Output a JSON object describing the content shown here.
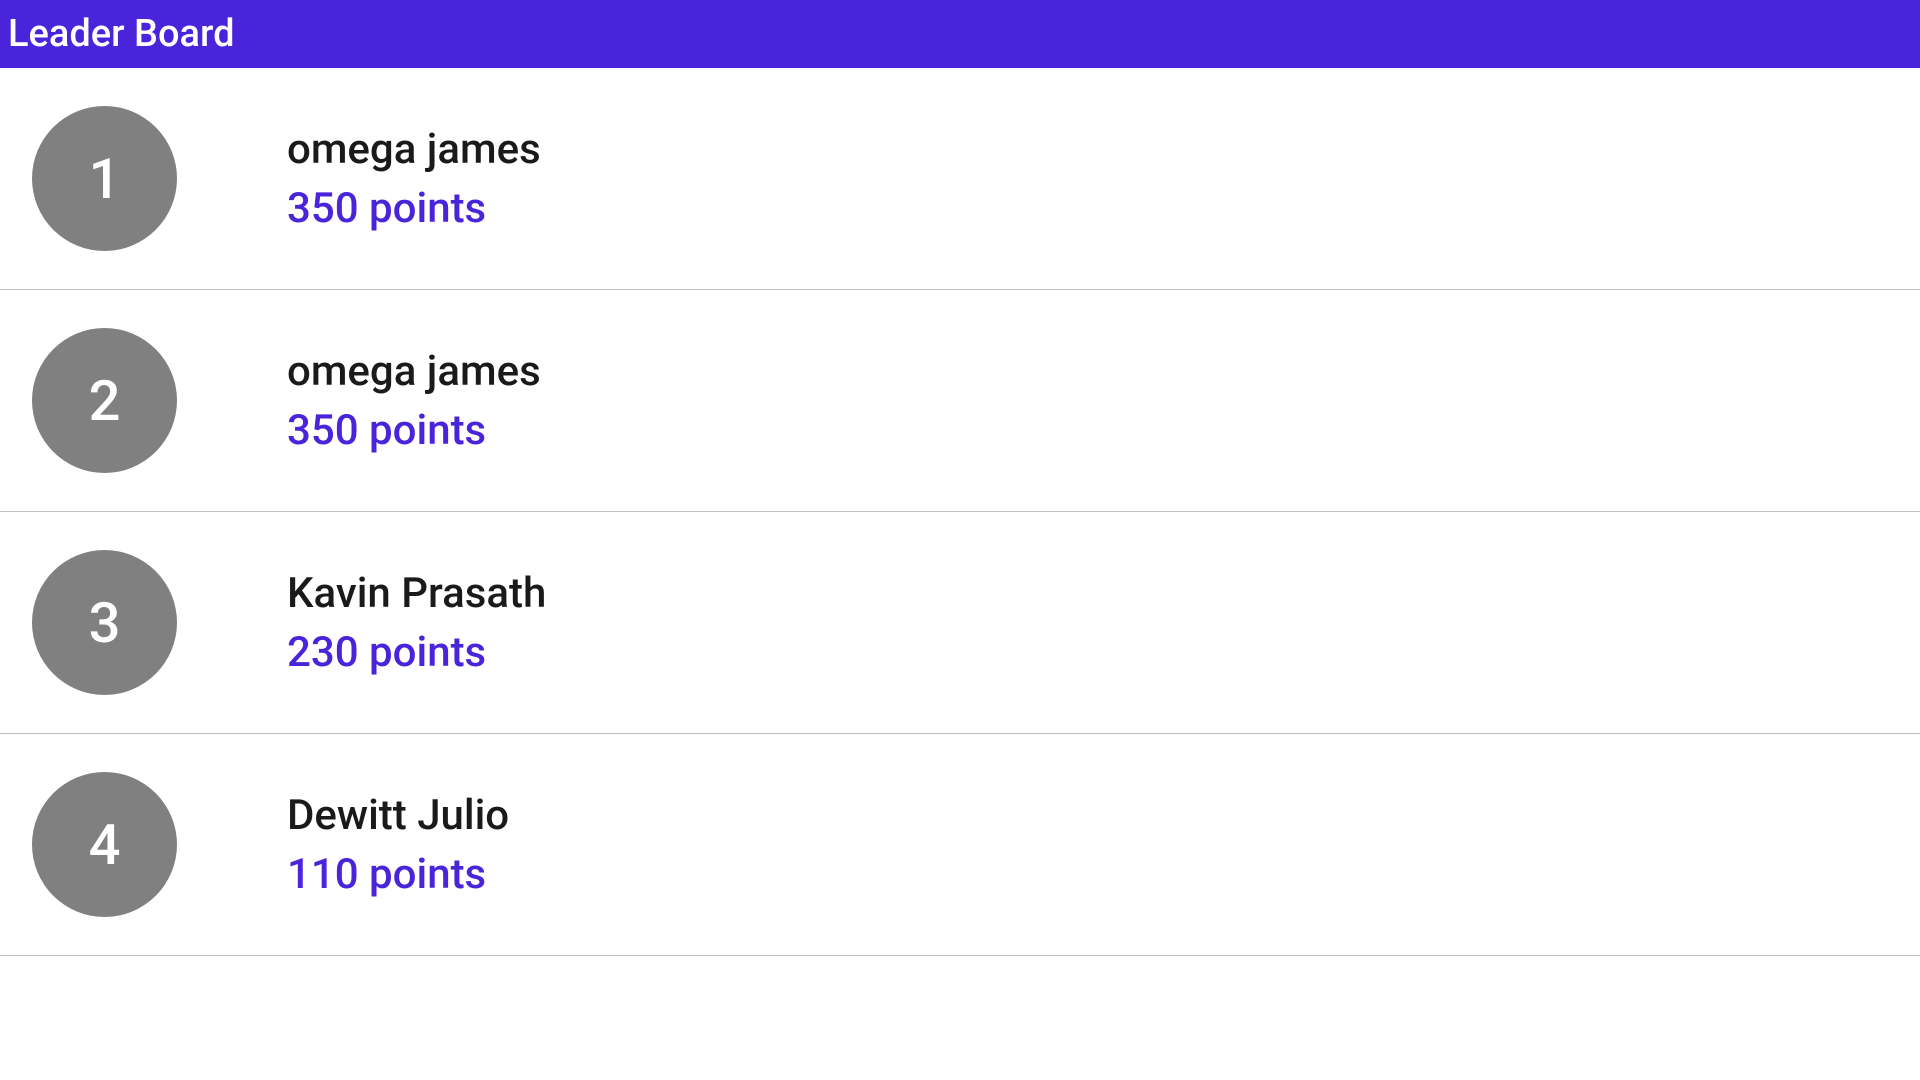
{
  "header": {
    "title": "Leader Board"
  },
  "leaderboard": {
    "items": [
      {
        "rank": "1",
        "name": "omega james",
        "points": "350 points"
      },
      {
        "rank": "2",
        "name": "omega james",
        "points": "350 points"
      },
      {
        "rank": "3",
        "name": "Kavin Prasath",
        "points": "230 points"
      },
      {
        "rank": "4",
        "name": "Dewitt Julio",
        "points": "110 points"
      }
    ]
  }
}
